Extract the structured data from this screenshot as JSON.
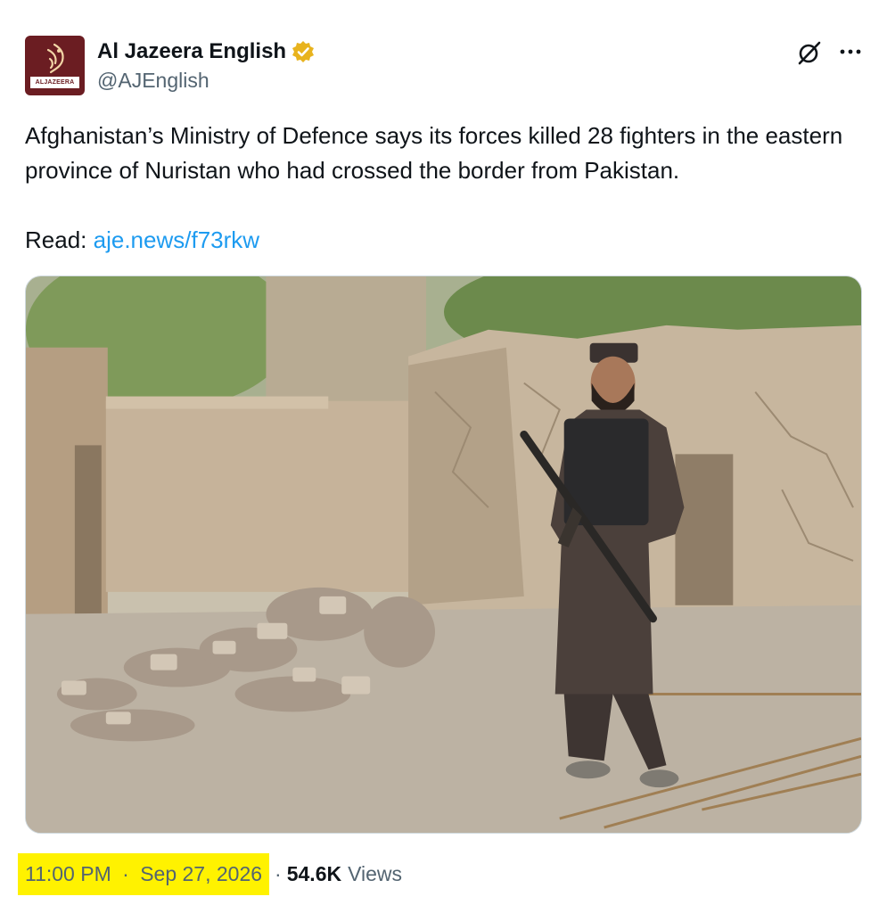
{
  "author": {
    "name": "Al Jazeera English",
    "handle": "@AJEnglish",
    "avatar_text": "ALJAZEERA",
    "verified": true,
    "verified_color": "#e8b31e"
  },
  "tweet": {
    "text": "Afghanistan’s Ministry of Defence says its forces killed 28 fighters in the eastern province of Nuristan who had crossed the border from Pakistan.",
    "read_label": "Read:",
    "link": "aje.news/f73rkw",
    "link_color": "#1d9bf0"
  },
  "footer": {
    "time": "11:00 PM",
    "date": "Sep 27, 2026",
    "separator": "·",
    "views_count": "54.6K",
    "views_label": "Views",
    "highlight_color": "#fff200"
  },
  "icons": {
    "verified": "verified-badge-icon",
    "grok": "grok-icon",
    "more": "more-options-icon"
  },
  "brand_color": "#6b1d22"
}
